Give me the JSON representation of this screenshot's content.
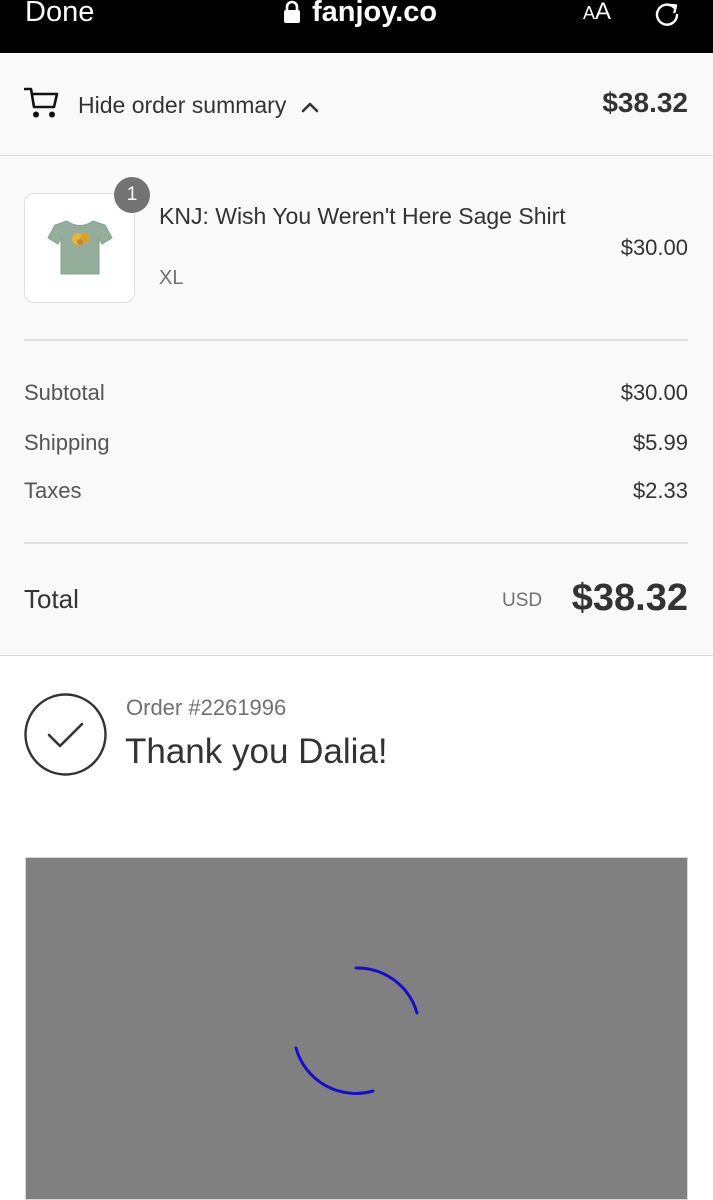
{
  "browser": {
    "done_label": "Done",
    "url": "fanjoy.co",
    "text_size_label_large": "A",
    "text_size_label_small": "A"
  },
  "summary": {
    "toggle_label": "Hide order summary",
    "toggle_total": "$38.32"
  },
  "product": {
    "quantity": "1",
    "name": "KNJ: Wish You Weren't Here Sage Shirt",
    "variant": "XL",
    "price": "$30.00",
    "image_color": "#95ae9c"
  },
  "lines": [
    {
      "label": "Subtotal",
      "value": "$30.00"
    },
    {
      "label": "Shipping",
      "value": "$5.99"
    },
    {
      "label": "Taxes",
      "value": "$2.33"
    }
  ],
  "total": {
    "label": "Total",
    "currency": "USD",
    "value": "$38.32"
  },
  "confirmation": {
    "order_number": "Order #2261996",
    "thank_you": "Thank you Dalia!"
  },
  "map": {
    "background": "#808080",
    "spinner_color": "#1a0ccf"
  },
  "icons": [
    "lock-icon",
    "reload-icon",
    "cart-icon",
    "chevron-up-icon",
    "tshirt-icon",
    "check-circle-icon",
    "spinner-icon"
  ]
}
